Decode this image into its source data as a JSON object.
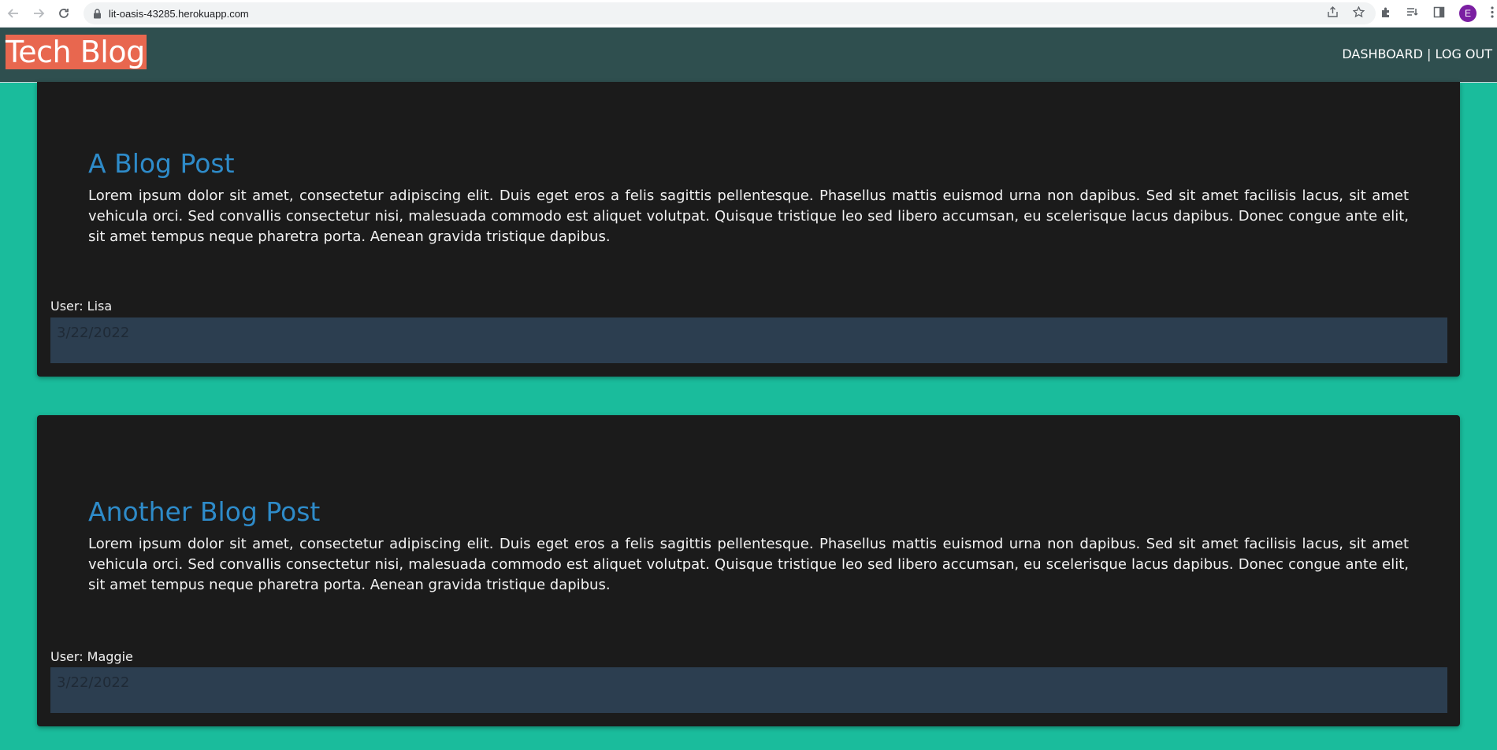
{
  "browser": {
    "url": "lit-oasis-43285.herokuapp.com",
    "profile_initial": "E"
  },
  "header": {
    "logo": "Tech Blog",
    "nav": {
      "dashboard": "DASHBOARD",
      "separator": " | ",
      "logout": "LOG OUT"
    }
  },
  "posts": [
    {
      "title": "A Blog Post",
      "body": "Lorem ipsum dolor sit amet, consectetur adipiscing elit. Duis eget eros a felis sagittis pellentesque. Phasellus mattis euismod urna non dapibus. Sed sit amet facilisis lacus, sit amet vehicula orci. Sed convallis consectetur nisi, malesuada commodo est aliquet volutpat. Quisque tristique leo sed libero accumsan, eu scelerisque lacus dapibus. Donec congue ante elit, sit amet tempus neque pharetra porta. Aenean gravida tristique dapibus.",
      "user": "User: Lisa",
      "date": "3/22/2022"
    },
    {
      "title": "Another Blog Post",
      "body": "Lorem ipsum dolor sit amet, consectetur adipiscing elit. Duis eget eros a felis sagittis pellentesque. Phasellus mattis euismod urna non dapibus. Sed sit amet facilisis lacus, sit amet vehicula orci. Sed convallis consectetur nisi, malesuada commodo est aliquet volutpat. Quisque tristique leo sed libero accumsan, eu scelerisque lacus dapibus. Donec congue ante elit, sit amet tempus neque pharetra porta. Aenean gravida tristique dapibus.",
      "user": "User: Maggie",
      "date": "3/22/2022"
    }
  ],
  "colors": {
    "page_background": "#1abc9c",
    "header_background": "#2f4f4f",
    "logo_background": "#e8674f",
    "card_background": "#1b1b1b",
    "title_color": "#2e8bc9",
    "date_bar": "#2c3e50"
  }
}
